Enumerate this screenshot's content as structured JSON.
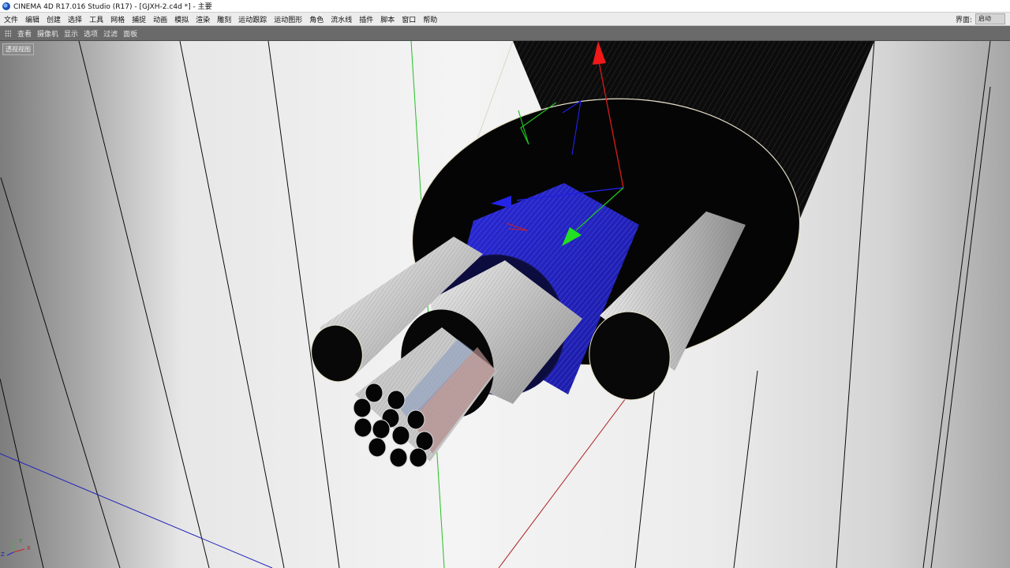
{
  "window": {
    "title": "CINEMA 4D R17.016 Studio (R17) - [GJXH-2.c4d *] - 主要"
  },
  "menubar": {
    "items": [
      "文件",
      "编辑",
      "创建",
      "选择",
      "工具",
      "网格",
      "捕捉",
      "动画",
      "模拟",
      "渲染",
      "雕刻",
      "运动跟踪",
      "运动图形",
      "角色",
      "流水线",
      "插件",
      "脚本",
      "窗口",
      "帮助"
    ],
    "layout_label": "界面:",
    "layout_value": "启动"
  },
  "viewport_menu": {
    "items": [
      "查看",
      "摄像机",
      "显示",
      "选项",
      "过滤",
      "面板"
    ]
  },
  "viewport": {
    "label": "透视视图",
    "axis_labels": {
      "x": "X",
      "y": "Y",
      "z": "Z"
    }
  },
  "colors": {
    "accent_x": "#e02020",
    "accent_y": "#1ed21e",
    "accent_z": "#2020e0",
    "menubar_bg": "#ececec",
    "viewport_menu_bg": "#6a6a6a"
  },
  "icons": [
    "cinema4d-app-icon",
    "viewport-menu-grip-icon",
    "axis-gizmo-icon",
    "move-handle-y-icon",
    "move-handle-x-icon",
    "move-handle-z-icon"
  ]
}
